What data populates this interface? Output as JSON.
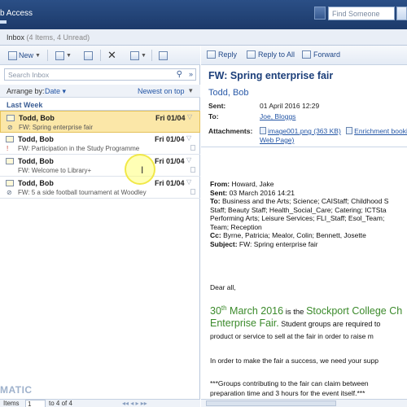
{
  "titlebar": {
    "title": "b Access",
    "find_placeholder": "Find Someone"
  },
  "inbox": {
    "label": "Inbox",
    "count": "(4 Items, 4 Unread)"
  },
  "toolbar": {
    "new_label": "New"
  },
  "search": {
    "placeholder": "Search Inbox"
  },
  "arrange": {
    "label": "Arrange by:",
    "by": "Date",
    "order": "Newest on top"
  },
  "group": {
    "label": "Last Week"
  },
  "messages": [
    {
      "from": "Todd, Bob",
      "date": "Fri 01/04",
      "subject": "FW: Spring enterprise fair",
      "selected": true
    },
    {
      "from": "Todd, Bob",
      "date": "Fri 01/04",
      "subject": "FW: Participation in the Study Programme",
      "selected": false
    },
    {
      "from": "Todd, Bob",
      "date": "Fri 01/04",
      "subject": "FW: Welcome to Library+",
      "selected": false
    },
    {
      "from": "Todd, Bob",
      "date": "Fri 01/04",
      "subject": "FW: 5 a side football tournament at Woodley",
      "selected": false
    }
  ],
  "pager": {
    "items_label": "Items",
    "current": "1",
    "total": "to 4 of 4"
  },
  "watermark": "MATIC",
  "reading": {
    "reply": "Reply",
    "reply_all": "Reply to All",
    "forward": "Forward",
    "subject": "FW: Spring enterprise fair",
    "sender": "Todd, Bob",
    "sent_label": "Sent:",
    "sent_value": "01 April 2016 12:29",
    "to_label": "To:",
    "to_value": "Joe, Bloggs",
    "attach_label": "Attachments:",
    "attach1": "image001.png (363 KB)",
    "attach2": "Enrichment bookin",
    "attach3": "Web Page)"
  },
  "body": {
    "from_label": "From:",
    "from_value": "Howard, Jake",
    "sent_label": "Sent:",
    "sent_value": "03 March 2016 14:21",
    "to_label": "To:",
    "to_value": "Business and the Arts; Science; CAIStaff; Childhood S",
    "to_line2": "Staff; Beauty Staff; Health_Social_Care; Catering; ICTSta",
    "to_line3": "Performing Arts; Leisure Services; FLI_Staff; Esol_Team;",
    "to_line4": "Team; Reception",
    "cc_label": "Cc:",
    "cc_value": "Byrne, Patricia; Mealor, Colin; Bennett, Josette",
    "subj_label": "Subject:",
    "subj_value": "FW: Spring enterprise fair",
    "greeting": "Dear all,",
    "date_num": "30",
    "date_sup": "th",
    "date_rest": " March 2016",
    "is_the": " is the ",
    "college": "Stockport College Ch",
    "fair": "Enterprise Fair.",
    "line1_rest": " Student groups are required to",
    "line2": "product or service to sell at the fair in order to raise m",
    "line3": "In order to make the fair a success, we need your supp",
    "line4": "***Groups contributing to the fair can claim between",
    "line5": "preparation time and 3 hours for the event itself.***"
  }
}
